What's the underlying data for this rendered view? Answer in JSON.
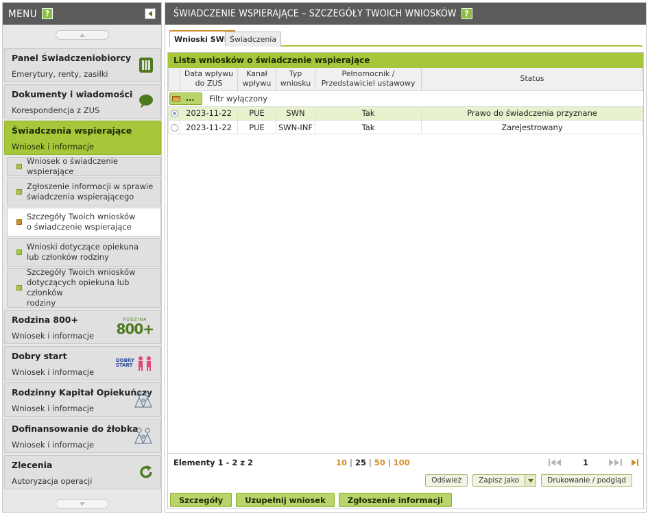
{
  "sidebar": {
    "menu_title": "MENU",
    "help_label": "?",
    "items": [
      {
        "title": "Panel Świadczeniobiorcy",
        "subtitle": "Emerytury, renty, zasiłki"
      },
      {
        "title": "Dokumenty i wiadomości",
        "subtitle": "Korespondencja z ZUS"
      },
      {
        "title": "Świadczenia wspierające",
        "subtitle": "Wniosek i informacje"
      },
      {
        "title": "Rodzina 800+",
        "subtitle": "Wniosek i informacje"
      },
      {
        "title": "Dobry start",
        "subtitle": "Wniosek i informacje"
      },
      {
        "title": "Rodzinny Kapitał Opiekuńczy",
        "subtitle": "Wniosek i informacje"
      },
      {
        "title": "Dofinansowanie do żłobka",
        "subtitle": "Wniosek i informacje"
      },
      {
        "title": "Zlecenia",
        "subtitle": "Autoryzacja operacji"
      }
    ],
    "subitems": [
      {
        "line1": "Wniosek o świadczenie wspierające",
        "line2": "",
        "line3": ""
      },
      {
        "line1": "Zgłoszenie informacji w sprawie",
        "line2": "świadczenia wspierającego",
        "line3": ""
      },
      {
        "line1": "Szczegóły Twoich wniosków",
        "line2": "o świadczenie wspierające",
        "line3": ""
      },
      {
        "line1": "Wnioski dotyczące opiekuna",
        "line2": "lub członków rodziny",
        "line3": ""
      },
      {
        "line1": "Szczegóły Twoich wniosków",
        "line2": "dotyczących opiekuna lub członków",
        "line3": "rodziny"
      }
    ],
    "logo_800_top": "RODZINA",
    "logo_800_num": "800+",
    "logo_dobry_start": "DOBRY",
    "logo_dobry_start2": "START"
  },
  "header": {
    "title": "ŚWIADCZENIE WSPIERAJĄCE – SZCZEGÓŁY TWOICH WNIOSKÓW",
    "help_label": "?"
  },
  "tabs": [
    {
      "label": "Wnioski SWN"
    },
    {
      "label": "Świadczenia"
    }
  ],
  "panel": {
    "title": "Lista wniosków o świadczenie wspierające",
    "columns": [
      {
        "line1": "Data wpływu",
        "line2": "do ZUS"
      },
      {
        "line1": "Kanał",
        "line2": "wpływu"
      },
      {
        "line1": "Typ",
        "line2": "wniosku"
      },
      {
        "line1": "Pełnomocnik /",
        "line2": "Przedstawiciel ustawowy"
      },
      {
        "line1": "Status",
        "line2": ""
      }
    ],
    "filter_button": "...",
    "filter_label": "Filtr wyłączony",
    "rows": [
      {
        "date": "2023-11-22",
        "channel": "PUE",
        "type": "SWN",
        "proxy": "Tak",
        "status": "Prawo do świadczenia przyznane"
      },
      {
        "date": "2023-11-22",
        "channel": "PUE",
        "type": "SWN-INF",
        "proxy": "Tak",
        "status": "Zarejestrowany"
      }
    ]
  },
  "pager": {
    "count_label": "Elementy 1 - 2 z 2",
    "sizes": [
      "10",
      "25",
      "50",
      "100"
    ],
    "current_page": "1"
  },
  "actions": {
    "refresh": "Odśwież",
    "save_as": "Zapisz jako",
    "print": "Drukowanie / podgląd"
  },
  "bottom": {
    "details": "Szczegóły",
    "complete": "Uzupełnij wniosek",
    "report": "Zgłoszenie informacji"
  },
  "colors": {
    "accent_green": "#a6c739",
    "header_gray": "#5b5b5b",
    "accent_orange": "#d28f2a"
  }
}
